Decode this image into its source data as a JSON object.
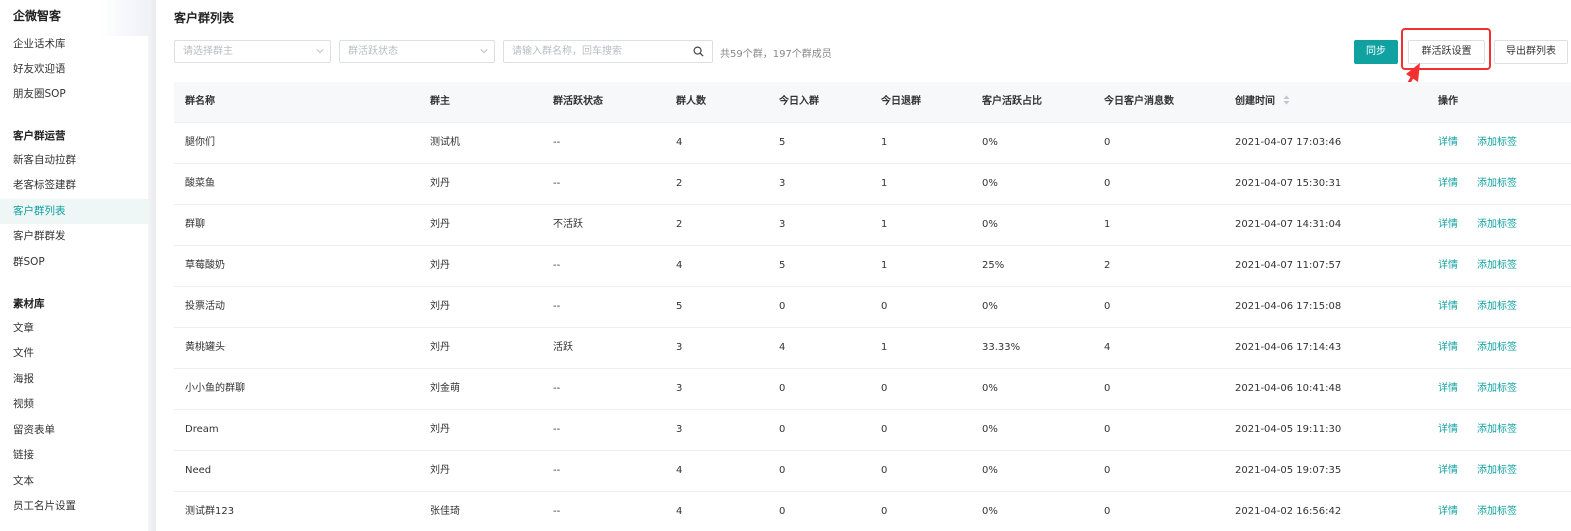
{
  "sidebar": {
    "brand": "企微智客",
    "group1": [
      {
        "label": "企业话术库"
      },
      {
        "label": "好友欢迎语"
      },
      {
        "label": "朋友圈SOP"
      }
    ],
    "section2": "客户群运营",
    "group2": [
      {
        "label": "新客自动拉群"
      },
      {
        "label": "老客标签建群"
      },
      {
        "label": "客户群列表"
      },
      {
        "label": "客户群群发"
      },
      {
        "label": "群SOP"
      }
    ],
    "section3": "素材库",
    "group3": [
      {
        "label": "文章"
      },
      {
        "label": "文件"
      },
      {
        "label": "海报"
      },
      {
        "label": "视频"
      },
      {
        "label": "留资表单"
      },
      {
        "label": "链接"
      },
      {
        "label": "文本"
      },
      {
        "label": "员工名片设置"
      }
    ]
  },
  "page": {
    "title": "客户群列表"
  },
  "filters": {
    "owner_placeholder": "请选择群主",
    "status_placeholder": "群活跃状态",
    "search_placeholder": "请输入群名称，回车搜索",
    "summary": "共59个群，197个群成员"
  },
  "toolbar": {
    "sync": "同步",
    "settings": "群活跃设置",
    "export": "导出群列表"
  },
  "table": {
    "headers": [
      "群名称",
      "群主",
      "群活跃状态",
      "群人数",
      "今日入群",
      "今日退群",
      "客户活跃占比",
      "今日客户消息数",
      "创建时间",
      "操作"
    ],
    "action_detail": "详情",
    "action_tag": "添加标签",
    "rows": [
      {
        "name": "腿你们",
        "owner": "测试机",
        "status": "--",
        "members": "4",
        "joined": "5",
        "left": "1",
        "ratio": "0%",
        "msgs": "0",
        "created": "2021-04-07 17:03:46"
      },
      {
        "name": "酸菜鱼",
        "owner": "刘丹",
        "status": "--",
        "members": "2",
        "joined": "3",
        "left": "1",
        "ratio": "0%",
        "msgs": "0",
        "created": "2021-04-07 15:30:31"
      },
      {
        "name": "群聊",
        "owner": "刘丹",
        "status": "不活跃",
        "members": "2",
        "joined": "3",
        "left": "1",
        "ratio": "0%",
        "msgs": "1",
        "created": "2021-04-07 14:31:04"
      },
      {
        "name": "草莓酸奶",
        "owner": "刘丹",
        "status": "--",
        "members": "4",
        "joined": "5",
        "left": "1",
        "ratio": "25%",
        "msgs": "2",
        "created": "2021-04-07 11:07:57"
      },
      {
        "name": "投票活动",
        "owner": "刘丹",
        "status": "--",
        "members": "5",
        "joined": "0",
        "left": "0",
        "ratio": "0%",
        "msgs": "0",
        "created": "2021-04-06 17:15:08"
      },
      {
        "name": "黄桃罐头",
        "owner": "刘丹",
        "status": "活跃",
        "members": "3",
        "joined": "4",
        "left": "1",
        "ratio": "33.33%",
        "msgs": "4",
        "created": "2021-04-06 17:14:43"
      },
      {
        "name": "小小鱼的群聊",
        "owner": "刘金萌",
        "status": "--",
        "members": "3",
        "joined": "0",
        "left": "0",
        "ratio": "0%",
        "msgs": "0",
        "created": "2021-04-06 10:41:48"
      },
      {
        "name": "Dream",
        "owner": "刘丹",
        "status": "--",
        "members": "3",
        "joined": "0",
        "left": "0",
        "ratio": "0%",
        "msgs": "0",
        "created": "2021-04-05 19:11:30"
      },
      {
        "name": "Need",
        "owner": "刘丹",
        "status": "--",
        "members": "4",
        "joined": "0",
        "left": "0",
        "ratio": "0%",
        "msgs": "0",
        "created": "2021-04-05 19:07:35"
      },
      {
        "name": "测试群123",
        "owner": "张佳琦",
        "status": "--",
        "members": "4",
        "joined": "0",
        "left": "0",
        "ratio": "0%",
        "msgs": "0",
        "created": "2021-04-02 16:56:42"
      }
    ]
  },
  "colors": {
    "accent": "#10a1a1",
    "highlight": "#f23030"
  }
}
